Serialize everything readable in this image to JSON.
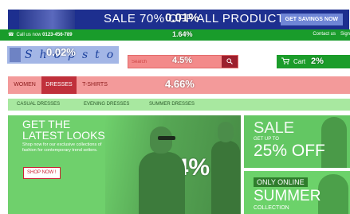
{
  "promo": {
    "text": "SALE 70% OFF ALL PRODUCTS",
    "button": "GET SAVINGS NOW",
    "overlay": "0.01%"
  },
  "infobar": {
    "phone_label": "Call us now",
    "phone_number": "0123-456-789",
    "contact": "Contact us",
    "signin": "Sign",
    "overlay": "1.64%"
  },
  "logo": {
    "text": "Shopstore",
    "overlay": "0.02%"
  },
  "search": {
    "placeholder": "Search",
    "overlay": "4.5%"
  },
  "cart": {
    "label": "Cart",
    "overlay": "2%"
  },
  "nav": {
    "items": [
      {
        "label": "WOMEN"
      },
      {
        "label": "DRESSES"
      },
      {
        "label": "T-SHIRTS"
      }
    ],
    "overlay": "4.66%"
  },
  "subnav": {
    "items": [
      {
        "label": "CASUAL DRESSES"
      },
      {
        "label": "EVENING DRESSES"
      },
      {
        "label": "SUMMER DRESSES"
      }
    ]
  },
  "hero": {
    "title_line1": "GET THE",
    "title_line2": "LATEST LOOKS",
    "subtitle": "Shop now for our exclusive collections of fashion for contemporary trend setters.",
    "button": "SHOP NOW !",
    "overlay": "2.24%"
  },
  "side_top": {
    "title": "SALE",
    "sub": "GET UP TO",
    "big": "25% OFF"
  },
  "side_bottom": {
    "tag": "ONLY ONLINE",
    "big": "SUMMER",
    "small": "COLLECTION"
  }
}
